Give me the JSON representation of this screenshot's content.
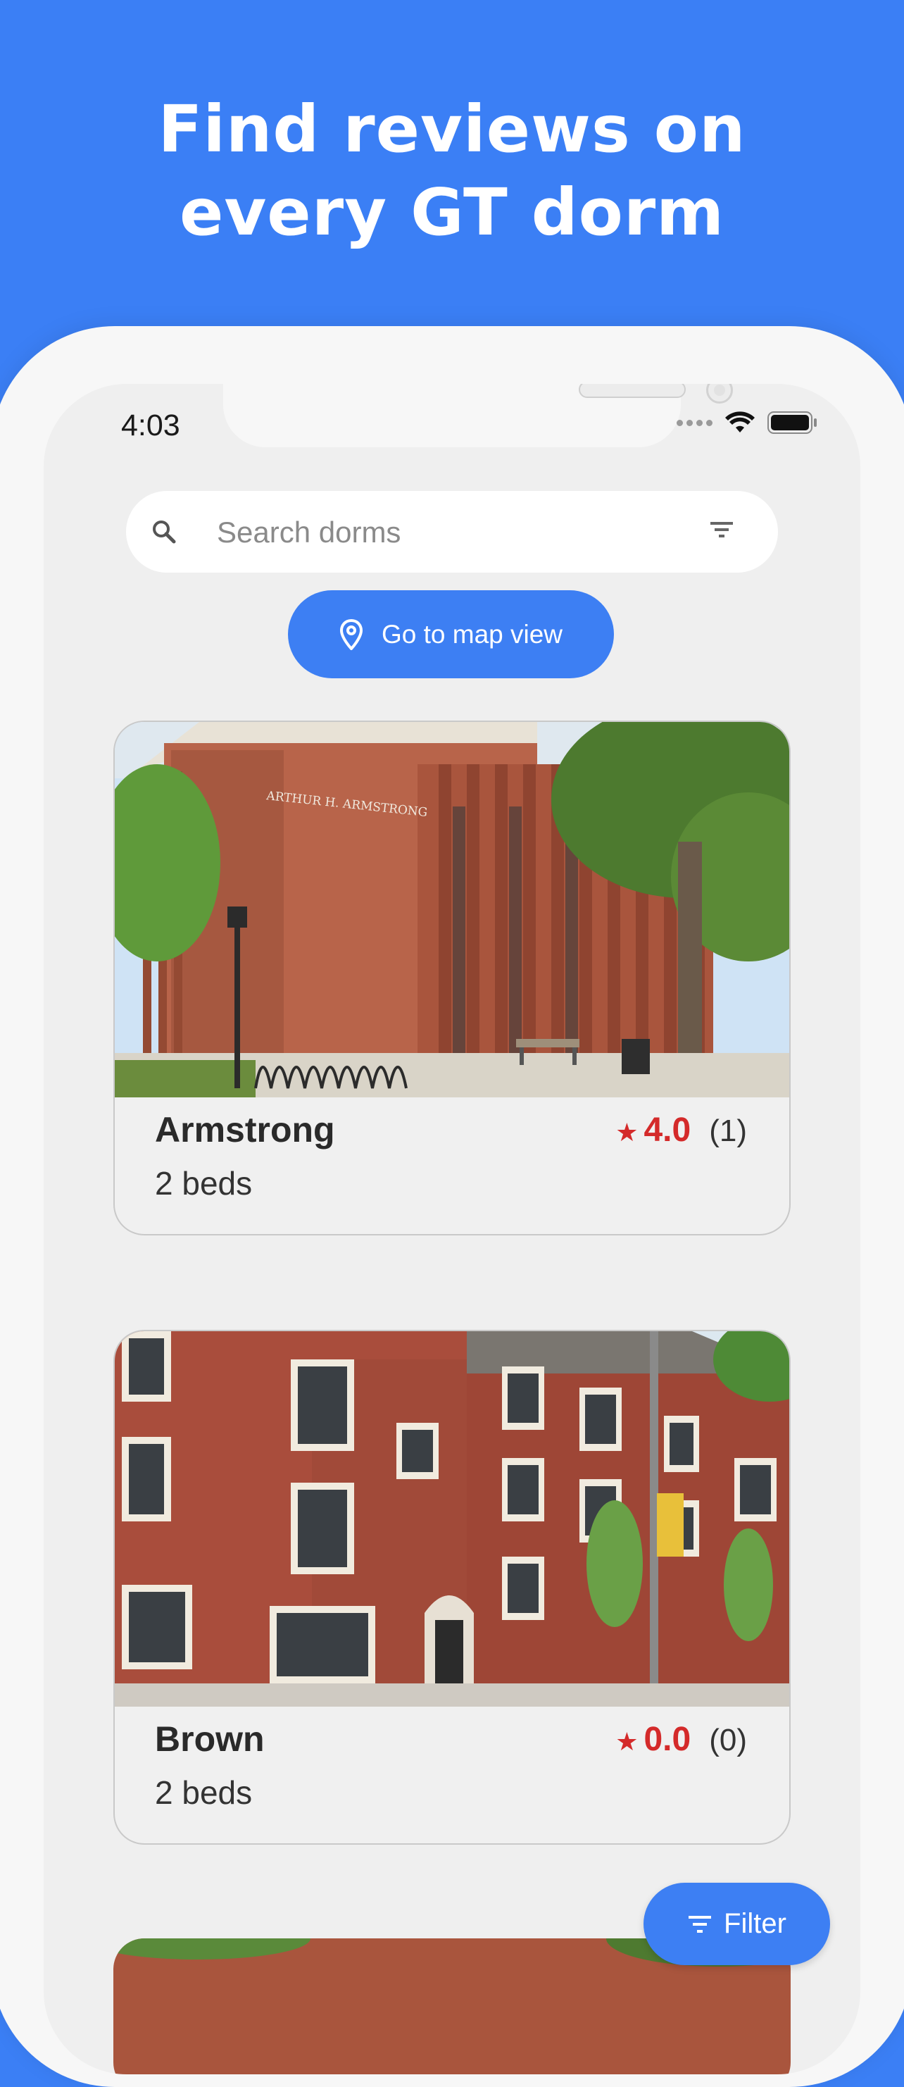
{
  "headline": {
    "line1": "Find reviews on",
    "line2": "every GT dorm"
  },
  "status_bar": {
    "time": "4:03"
  },
  "search": {
    "placeholder": "Search dorms"
  },
  "map_button": {
    "label": "Go to map view"
  },
  "dorms": [
    {
      "name": "Armstrong",
      "beds": "2 beds",
      "rating": "4.0",
      "review_count": "(1)",
      "sign_text": "ARTHUR H. ARMSTRONG"
    },
    {
      "name": "Brown",
      "beds": "2 beds",
      "rating": "0.0",
      "review_count": "(0)"
    }
  ],
  "filter_button": {
    "label": "Filter"
  },
  "colors": {
    "background": "#3b7ff5",
    "accent_button": "#3d7ff3",
    "rating_red": "#d42a2a",
    "screen_bg": "#efefef"
  },
  "icons": [
    "search-icon",
    "filter-lines-icon",
    "map-pin-icon",
    "star-icon",
    "wifi-icon",
    "battery-icon"
  ]
}
